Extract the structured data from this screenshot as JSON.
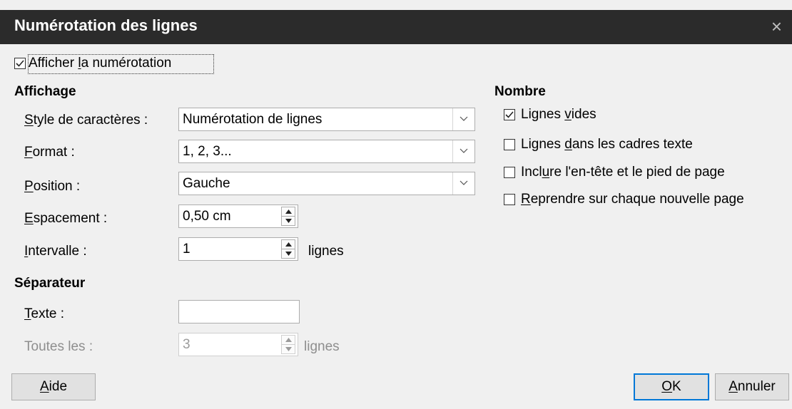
{
  "window": {
    "title": "Numérotation des lignes",
    "close_glyph": "×"
  },
  "show_numbering": {
    "pre": "Afficher ",
    "key": "l",
    "post": "a numérotation",
    "checked": true
  },
  "affichage": {
    "heading": "Affichage",
    "char_style": {
      "key": "S",
      "label_rest": "tyle de caractères :",
      "value": "Numérotation de lignes"
    },
    "format": {
      "key": "F",
      "label_rest": "ormat :",
      "value": "1, 2, 3..."
    },
    "position": {
      "key": "P",
      "label_rest": "osition :",
      "value": "Gauche"
    },
    "spacing": {
      "key": "E",
      "label_rest": "spacement :",
      "value": "0,50 cm"
    },
    "interval": {
      "key": "I",
      "label_rest": "ntervalle :",
      "value": "1",
      "unit": "lignes"
    }
  },
  "separator": {
    "heading": "Séparateur",
    "text": {
      "key": "T",
      "label_rest": "exte :",
      "value": ""
    },
    "every": {
      "label": "Toutes les :",
      "value": "3",
      "unit": "lignes"
    }
  },
  "nombre": {
    "heading": "Nombre",
    "blank_lines": {
      "pre": "Lignes ",
      "key": "v",
      "post": "ides",
      "checked": true
    },
    "text_frames": {
      "pre": "Lignes ",
      "key": "d",
      "post": "ans les cadres texte",
      "checked": false
    },
    "header_footer": {
      "pre": "Incl",
      "key": "u",
      "post": "re l'en-tête et le pied de page",
      "checked": false
    },
    "restart": {
      "pre": "",
      "key": "R",
      "post": "eprendre sur chaque nouvelle page",
      "checked": false
    }
  },
  "buttons": {
    "help": {
      "key": "A",
      "rest": "ide"
    },
    "ok": {
      "key": "O",
      "rest": "K"
    },
    "cancel": {
      "key": "A",
      "rest": "nnuler"
    }
  }
}
